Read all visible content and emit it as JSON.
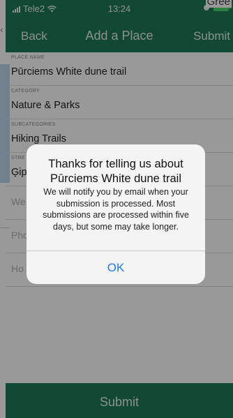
{
  "status_bar": {
    "carrier": "Tele2",
    "time": "13:24"
  },
  "corner_text": "Gree",
  "nav": {
    "back_label": "Back",
    "title": "Add a Place",
    "submit_label": "Submit"
  },
  "form": {
    "place_name_label": "PLACE NAME",
    "place_name_value": "Pūrciems White dune trail",
    "category_label": "CATEGORY",
    "category_value": "Nature & Parks",
    "subcategories_label": "SUBCATEGORIES",
    "subcategories_value": "Hiking Trails",
    "street_label": "STRE",
    "street_value": "Ģip",
    "website_placeholder": "We",
    "phone_placeholder": "Pho",
    "hours_placeholder": "Ho"
  },
  "bottom_bar": {
    "submit_label": "Submit"
  },
  "alert": {
    "title": "Thanks for telling us about Pūrciems White dune trail",
    "message": "We will notify you by email when your submission is processed. Most submissions are processed within five days, but some may take longer.",
    "ok_label": "OK"
  },
  "colors": {
    "brand_green": "#1f7a57",
    "alert_button_blue": "#1a7aff",
    "battery_green": "#48d867"
  },
  "icons": {
    "signal": "signal-bars-icon",
    "wifi": "wifi-icon",
    "alarm": "alarm-icon",
    "battery": "battery-icon"
  }
}
